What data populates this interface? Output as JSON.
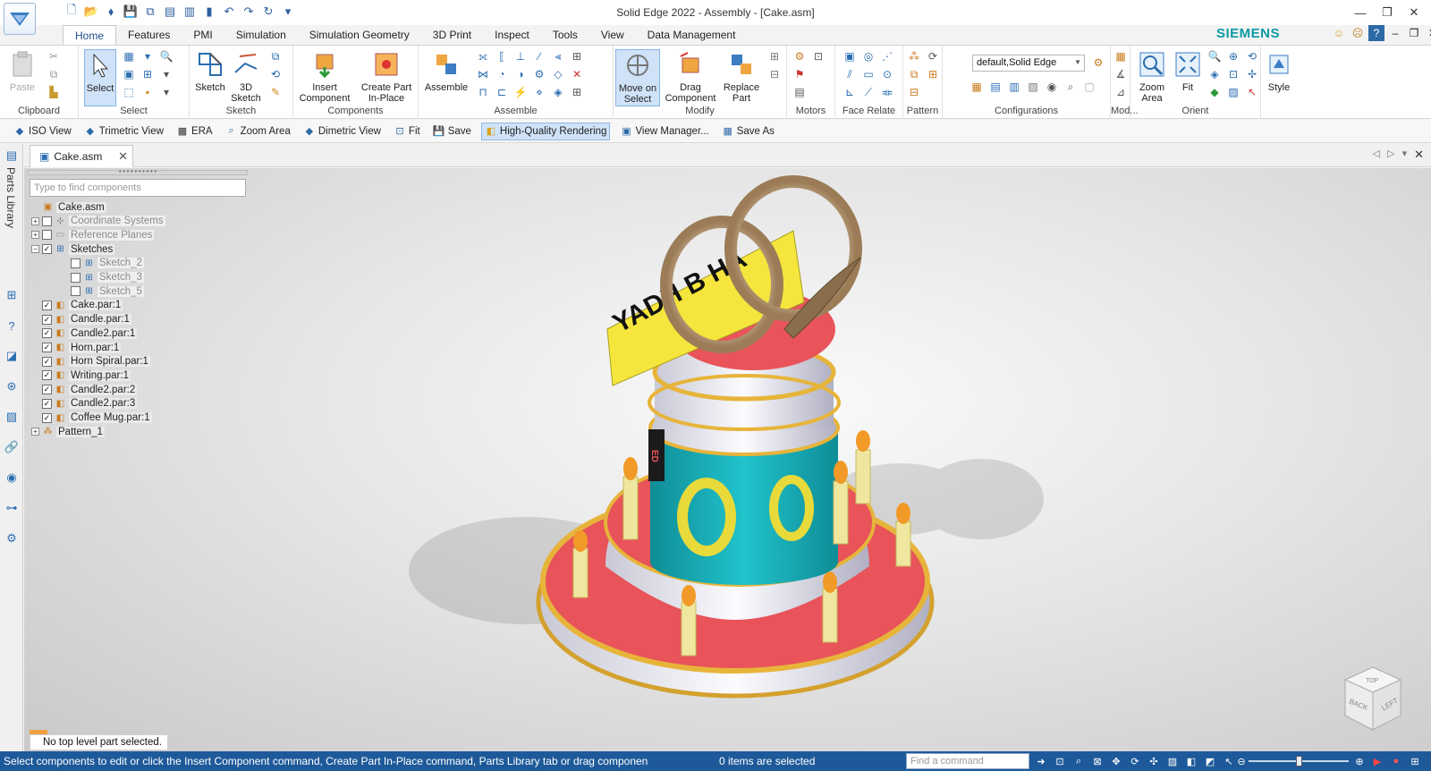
{
  "window": {
    "title": "Solid Edge 2022 - Assembly - [Cake.asm]",
    "brand": "SIEMENS"
  },
  "ribbon": {
    "tabs": [
      "Home",
      "Features",
      "PMI",
      "Simulation",
      "Simulation Geometry",
      "3D Print",
      "Inspect",
      "Tools",
      "View",
      "Data Management"
    ],
    "active_tab": "Home",
    "groups": {
      "clipboard": {
        "label": "Clipboard",
        "paste": "Paste"
      },
      "select": {
        "label": "Select",
        "select": "Select"
      },
      "sketch": {
        "label": "Sketch",
        "sketch": "Sketch",
        "sketch3d_line1": "3D",
        "sketch3d_line2": "Sketch"
      },
      "components": {
        "label": "Components",
        "insert_line1": "Insert",
        "insert_line2": "Component",
        "create_line1": "Create Part",
        "create_line2": "In-Place"
      },
      "assemble": {
        "label": "Assemble",
        "assemble": "Assemble"
      },
      "modify": {
        "label": "Modify",
        "move_line1": "Move on",
        "move_line2": "Select",
        "drag_line1": "Drag",
        "drag_line2": "Component",
        "replace_line1": "Replace",
        "replace_line2": "Part"
      },
      "motors": {
        "label": "Motors"
      },
      "face_relate": {
        "label": "Face Relate"
      },
      "pattern": {
        "label": "Pattern"
      },
      "configurations": {
        "label": "Configurations",
        "selected": "default,Solid Edge"
      },
      "model": {
        "label": "Mod..."
      },
      "orient": {
        "label": "Orient",
        "zoom_line1": "Zoom",
        "zoom_line2": "Area",
        "fit": "Fit"
      },
      "style": {
        "style": "Style"
      }
    }
  },
  "view_toolbar": [
    {
      "label": "ISO View",
      "icon": "iso-view-icon"
    },
    {
      "label": "Trimetric View",
      "icon": "trimetric-view-icon"
    },
    {
      "label": "ERA",
      "icon": "era-icon"
    },
    {
      "label": "Zoom Area",
      "icon": "zoom-area-icon"
    },
    {
      "label": "Dimetric View",
      "icon": "dimetric-view-icon"
    },
    {
      "label": "Fit",
      "icon": "fit-icon"
    },
    {
      "label": "Save",
      "icon": "save-icon"
    },
    {
      "label": "High-Quality Rendering",
      "icon": "rendering-icon",
      "active": true
    },
    {
      "label": "View Manager...",
      "icon": "view-manager-icon"
    },
    {
      "label": "Save As",
      "icon": "save-as-icon"
    }
  ],
  "left_rail": {
    "parts_library": "Parts Library"
  },
  "document": {
    "tab_name": "Cake.asm"
  },
  "pathfinder": {
    "search_placeholder": "Type to find components",
    "tree": [
      {
        "label": "Cake.asm",
        "level": 0,
        "expander": "",
        "checkbox": false,
        "dim": false
      },
      {
        "label": "Coordinate Systems",
        "level": 1,
        "expander": "+",
        "checkbox": "off",
        "dim": true
      },
      {
        "label": "Reference Planes",
        "level": 1,
        "expander": "+",
        "checkbox": "off",
        "dim": true
      },
      {
        "label": "Sketches",
        "level": 1,
        "expander": "−",
        "checkbox": "on",
        "dim": false
      },
      {
        "label": "Sketch_2",
        "level": 2,
        "expander": "",
        "checkbox": "off",
        "dim": true
      },
      {
        "label": "Sketch_3",
        "level": 2,
        "expander": "",
        "checkbox": "off",
        "dim": true
      },
      {
        "label": "Sketch_5",
        "level": 2,
        "expander": "",
        "checkbox": "off",
        "dim": true
      },
      {
        "label": "Cake.par:1",
        "level": 1,
        "expander": "",
        "checkbox": "on",
        "dim": false
      },
      {
        "label": "Candle.par:1",
        "level": 1,
        "expander": "",
        "checkbox": "on",
        "dim": false
      },
      {
        "label": "Candle2.par:1",
        "level": 1,
        "expander": "",
        "checkbox": "on",
        "dim": false
      },
      {
        "label": "Horn.par:1",
        "level": 1,
        "expander": "",
        "checkbox": "on",
        "dim": false
      },
      {
        "label": "Horn Spiral.par:1",
        "level": 1,
        "expander": "",
        "checkbox": "on",
        "dim": false
      },
      {
        "label": "Writing.par:1",
        "level": 1,
        "expander": "",
        "checkbox": "on",
        "dim": false
      },
      {
        "label": "Candle2.par:2",
        "level": 1,
        "expander": "",
        "checkbox": "on",
        "dim": false
      },
      {
        "label": "Candle2.par:3",
        "level": 1,
        "expander": "",
        "checkbox": "on",
        "dim": false
      },
      {
        "label": "Coffee Mug.par:1",
        "level": 1,
        "expander": "",
        "checkbox": "on",
        "dim": false
      },
      {
        "label": "Pattern_1",
        "level": 0,
        "expander": "+",
        "checkbox": false,
        "dim": false
      }
    ]
  },
  "viewport": {
    "banner_text": "YADH   B   HA",
    "mug_text": "ED",
    "view_cube": {
      "faces": [
        "TOP",
        "BACK",
        "LEFT"
      ]
    }
  },
  "prompt": "No top level part selected.",
  "status": {
    "message": "Select components to edit or click the Insert Component command, Create Part In-Place command, Parts Library tab or drag componen",
    "selection": "0 items are selected",
    "find_placeholder": "Find a command"
  },
  "colors": {
    "status_bar": "#1e5a9a",
    "brand": "#0b9aa5",
    "cake_red": "#e8545a",
    "cake_teal": "#14a8b0",
    "gold": "#e7b43a"
  }
}
